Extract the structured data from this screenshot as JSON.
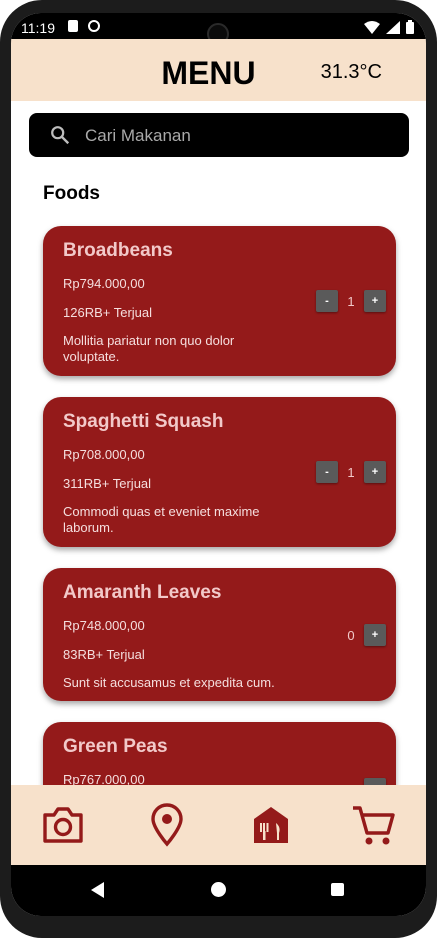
{
  "status_bar": {
    "time": "11:19"
  },
  "header": {
    "title": "MENU",
    "temperature": "31.3°C"
  },
  "search": {
    "placeholder": "Cari Makanan",
    "value": ""
  },
  "section": {
    "title": "Foods"
  },
  "foods": [
    {
      "name": "Broadbeans",
      "price": "Rp794.000,00",
      "sold": "126RB+ Terjual",
      "description": "Mollitia pariatur non quo dolor voluptate.",
      "qty": "1",
      "minus": "-",
      "plus": "+"
    },
    {
      "name": "Spaghetti Squash",
      "price": "Rp708.000,00",
      "sold": "311RB+ Terjual",
      "description": "Commodi quas et eveniet maxime laborum.",
      "qty": "1",
      "minus": "-",
      "plus": "+"
    },
    {
      "name": "Amaranth Leaves",
      "price": "Rp748.000,00",
      "sold": "83RB+ Terjual",
      "description": "Sunt sit accusamus et expedita cum.",
      "qty": "0",
      "plus": "+"
    },
    {
      "name": "Green Peas",
      "price": "Rp767.000,00",
      "plus": "+"
    }
  ],
  "bottom_nav": {
    "items": [
      "camera-icon",
      "location-pin-icon",
      "restaurant-icon",
      "cart-icon"
    ],
    "icon_color": "#941a1a"
  },
  "colors": {
    "card": "#941a1a",
    "header_bg": "#f7e1cb",
    "search_bg": "#000000"
  }
}
